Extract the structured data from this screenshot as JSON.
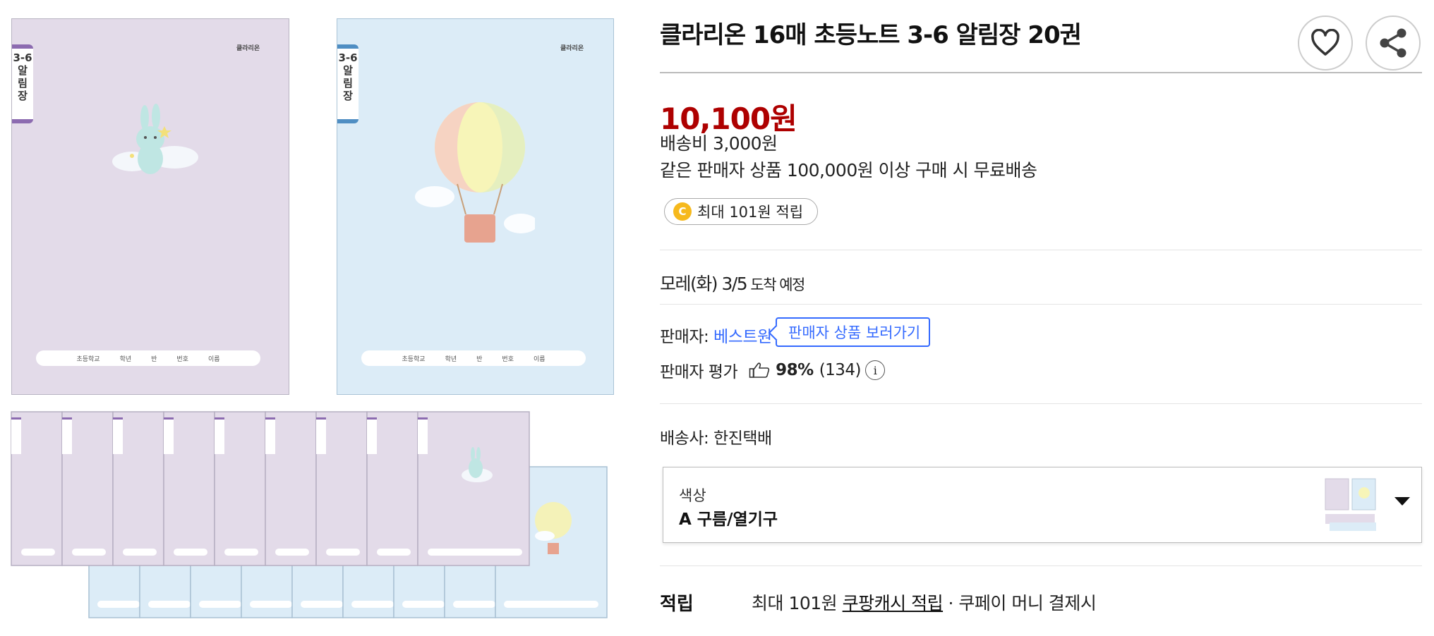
{
  "gallery": {
    "notebook_a": {
      "spine_text": [
        "3-6",
        "알",
        "림",
        "장"
      ],
      "brand": "클라리온"
    },
    "notebook_b": {
      "spine_text": [
        "3-6",
        "알",
        "림",
        "장"
      ],
      "brand": "클라리온"
    },
    "nameplate_fields": [
      "초등학교",
      "학년",
      "반",
      "번호",
      "이름"
    ],
    "colors": {
      "purple": "#e3dbe9",
      "blue": "#dcecf7",
      "spine_purple": "#8c6bb0",
      "spine_blue": "#4f8ec3"
    }
  },
  "product": {
    "title": "클라리온 16매 초등노트 3-6 알림장 20권",
    "price": "10,100원",
    "shipping_fee": "배송비 3,000원",
    "free_shipping": "같은 판매자 상품 100,000원 이상 구매 시 무료배송",
    "cash_badge": {
      "coin": "C",
      "text": "최대 101원 적립"
    },
    "delivery": {
      "main": "모레(화) 3/5",
      "suffix": " 도착 예정"
    },
    "seller": {
      "label": "판매자:",
      "name": "베스트원",
      "button": "판매자 상품 보러가기"
    },
    "rating": {
      "label": "판매자 평가",
      "percent": "98%",
      "count": "(134)",
      "info": "i"
    },
    "courier": "배송사: 한진택배",
    "option": {
      "label": "색상",
      "value": "A 구름/열기구"
    },
    "reward": {
      "label": "적립",
      "prefix": "최대 101원 ",
      "link": "쿠팡캐시 적립",
      "suffix": " · 쿠페이 머니 결제시"
    }
  },
  "icons": [
    "heart-icon",
    "share-icon",
    "thumbs-up-icon",
    "info-icon",
    "chevron-down-icon",
    "coin-icon"
  ],
  "accent_colors": {
    "price": "#ae0000",
    "link": "#346aff",
    "coin": "#f6b91d"
  }
}
